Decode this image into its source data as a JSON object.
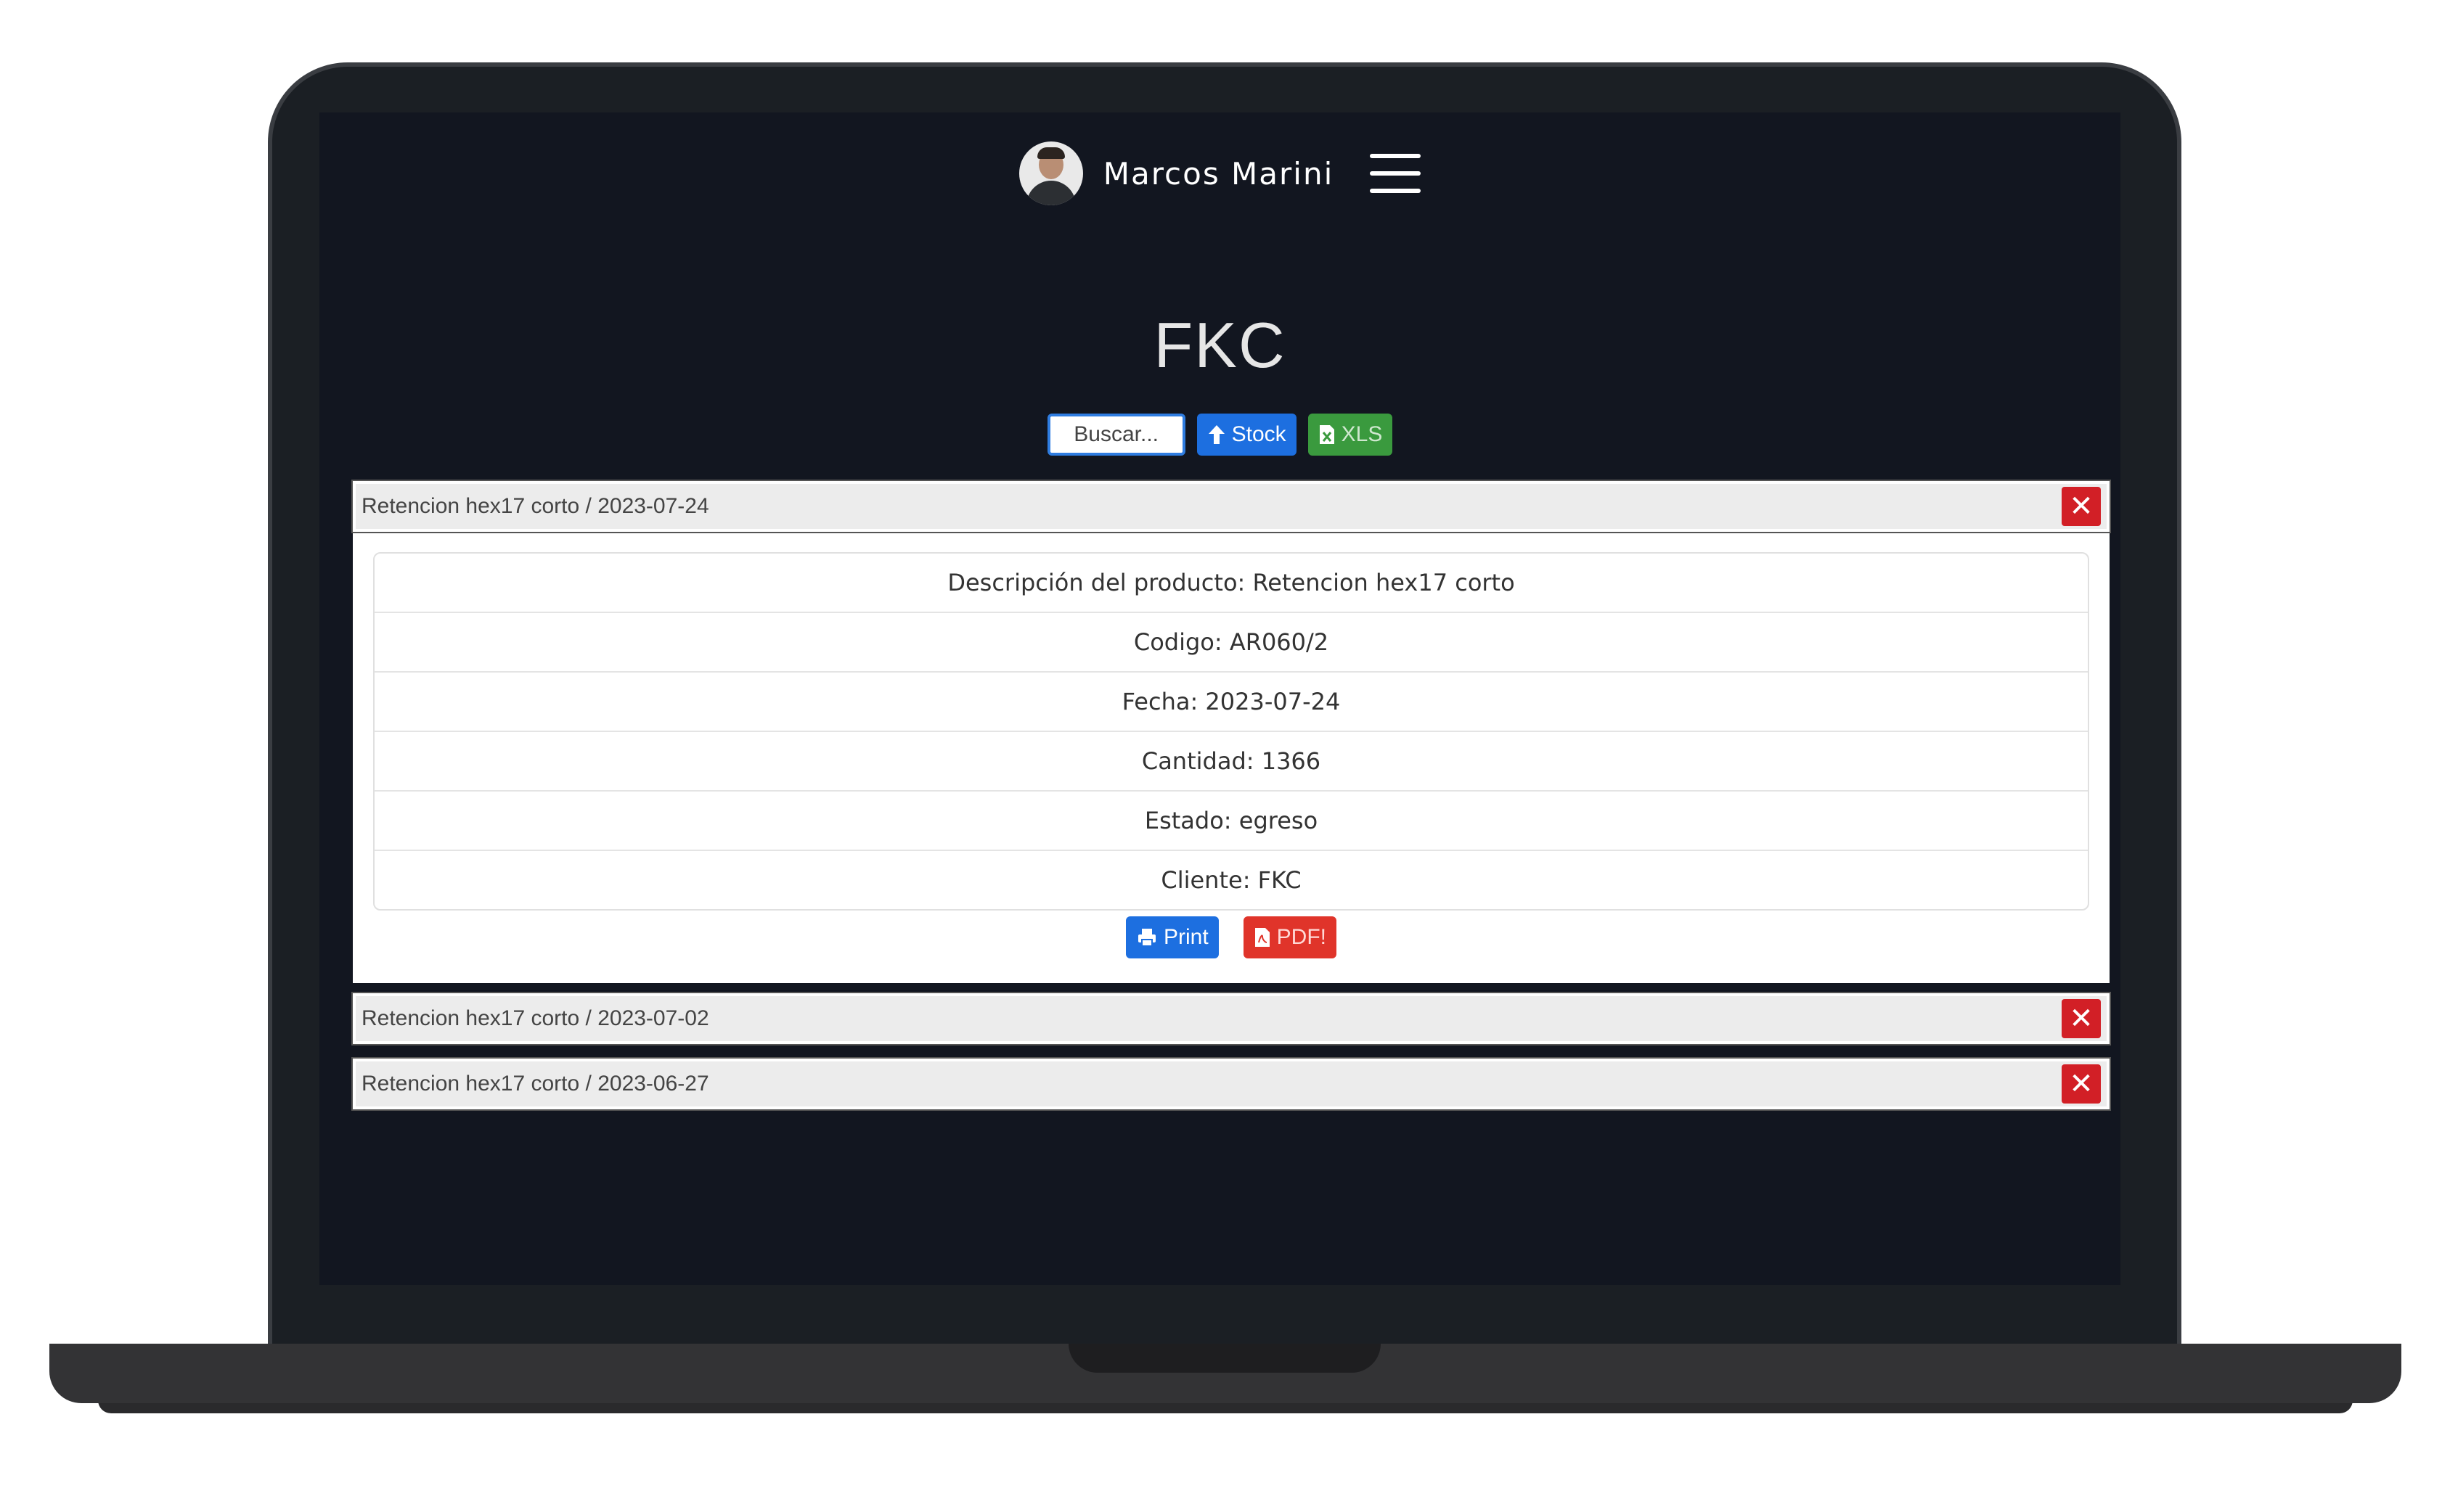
{
  "user": {
    "name": "Marcos Marini"
  },
  "page": {
    "title": "FKC"
  },
  "toolbar": {
    "search_placeholder": "Buscar...",
    "stock_label": "Stock",
    "xls_label": "XLS"
  },
  "records": [
    {
      "header": "Retencion hex17 corto / 2023-07-24",
      "expanded": true,
      "details": {
        "descripcion_label": "Descripción del producto:",
        "descripcion": "Retencion hex17 corto",
        "codigo_label": "Codigo:",
        "codigo": "AR060/2",
        "fecha_label": "Fecha:",
        "fecha": "2023-07-24",
        "cantidad_label": "Cantidad:",
        "cantidad": "1366",
        "estado_label": "Estado:",
        "estado": "egreso",
        "cliente_label": "Cliente:",
        "cliente": "FKC"
      },
      "print_label": "Print",
      "pdf_label": "PDF!"
    },
    {
      "header": "Retencion hex17 corto / 2023-07-02",
      "expanded": false
    },
    {
      "header": "Retencion hex17 corto / 2023-06-27",
      "expanded": false
    }
  ],
  "close_symbol": "✕",
  "colors": {
    "screen_bg": "#121620",
    "primary": "#1d6fe0",
    "success": "#3a9a3e",
    "danger": "#d21f26",
    "pdf": "#e0342a"
  }
}
